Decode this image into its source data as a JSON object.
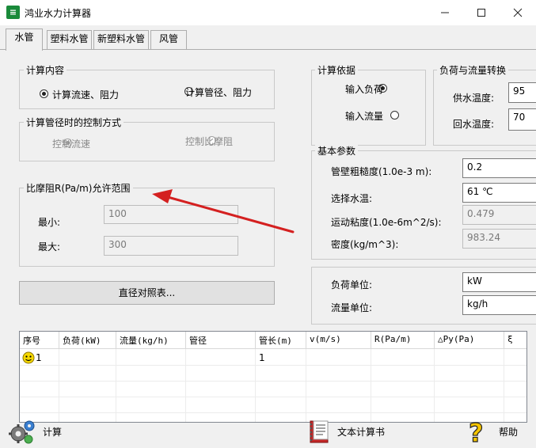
{
  "window": {
    "title": "鸿业水力计算器",
    "icon": "app-logo-icon",
    "controls": [
      "minimize",
      "maximize",
      "close"
    ]
  },
  "tabs": [
    {
      "label": "水管",
      "active": true
    },
    {
      "label": "塑料水管",
      "active": false
    },
    {
      "label": "新塑料水管",
      "active": false
    },
    {
      "label": "风管",
      "active": false
    }
  ],
  "calc_content": {
    "title": "计算内容",
    "options": [
      {
        "label": "计算流速、阻力",
        "selected": true
      },
      {
        "label": "计算管径、阻力",
        "selected": false
      }
    ]
  },
  "control_mode": {
    "title": "计算管径时的控制方式",
    "options": [
      {
        "label": "控制流速",
        "selected": true
      },
      {
        "label": "控制比摩阻",
        "selected": false
      }
    ]
  },
  "friction_range": {
    "title": "比摩阻R(Pa/m)允许范围",
    "min_label": "最小:",
    "min_value": "100",
    "max_label": "最大:",
    "max_value": "300"
  },
  "diameter_table_button": "直径对照表...",
  "calc_basis": {
    "title": "计算依据",
    "options": [
      {
        "label": "输入负荷",
        "selected": true
      },
      {
        "label": "输入流量",
        "selected": false
      }
    ]
  },
  "load_flow": {
    "title": "负荷与流量转换",
    "supply_label": "供水温度:",
    "supply_value": "95",
    "return_label": "回水温度:",
    "return_value": "70"
  },
  "basic_params": {
    "title": "基本参数",
    "roughness_label": "管壁粗糙度(1.0e-3 m):",
    "roughness_value": "0.2",
    "water_temp_label": "选择水温:",
    "water_temp_value": "61 ℃",
    "viscosity_label": "运动粘度(1.0e-6m^2/s):",
    "viscosity_value": "0.479",
    "density_label": "密度(kg/m^3):",
    "density_value": "983.24"
  },
  "units": {
    "load_label": "负荷单位:",
    "load_value": "kW",
    "flow_label": "流量单位:",
    "flow_value": "kg/h"
  },
  "grid": {
    "columns": [
      "序号",
      "负荷(kW)",
      "流量(kg/h)",
      "管径",
      "管长(m)",
      "v(m/s)",
      "R(Pa/m)",
      "△Py(Pa)",
      "ξ"
    ],
    "rows": [
      {
        "index": "1",
        "load": "",
        "flow": "",
        "diameter": "",
        "length": "1",
        "velocity": "",
        "r": "",
        "dpy": "",
        "xi": ""
      }
    ]
  },
  "toolbar": {
    "calculate": "计算",
    "text_report": "文本计算书",
    "help": "帮助"
  },
  "colors": {
    "window_bg": "#f0f0f0",
    "annotation_arrow": "#d42020",
    "row_icon": "#f5d800"
  }
}
